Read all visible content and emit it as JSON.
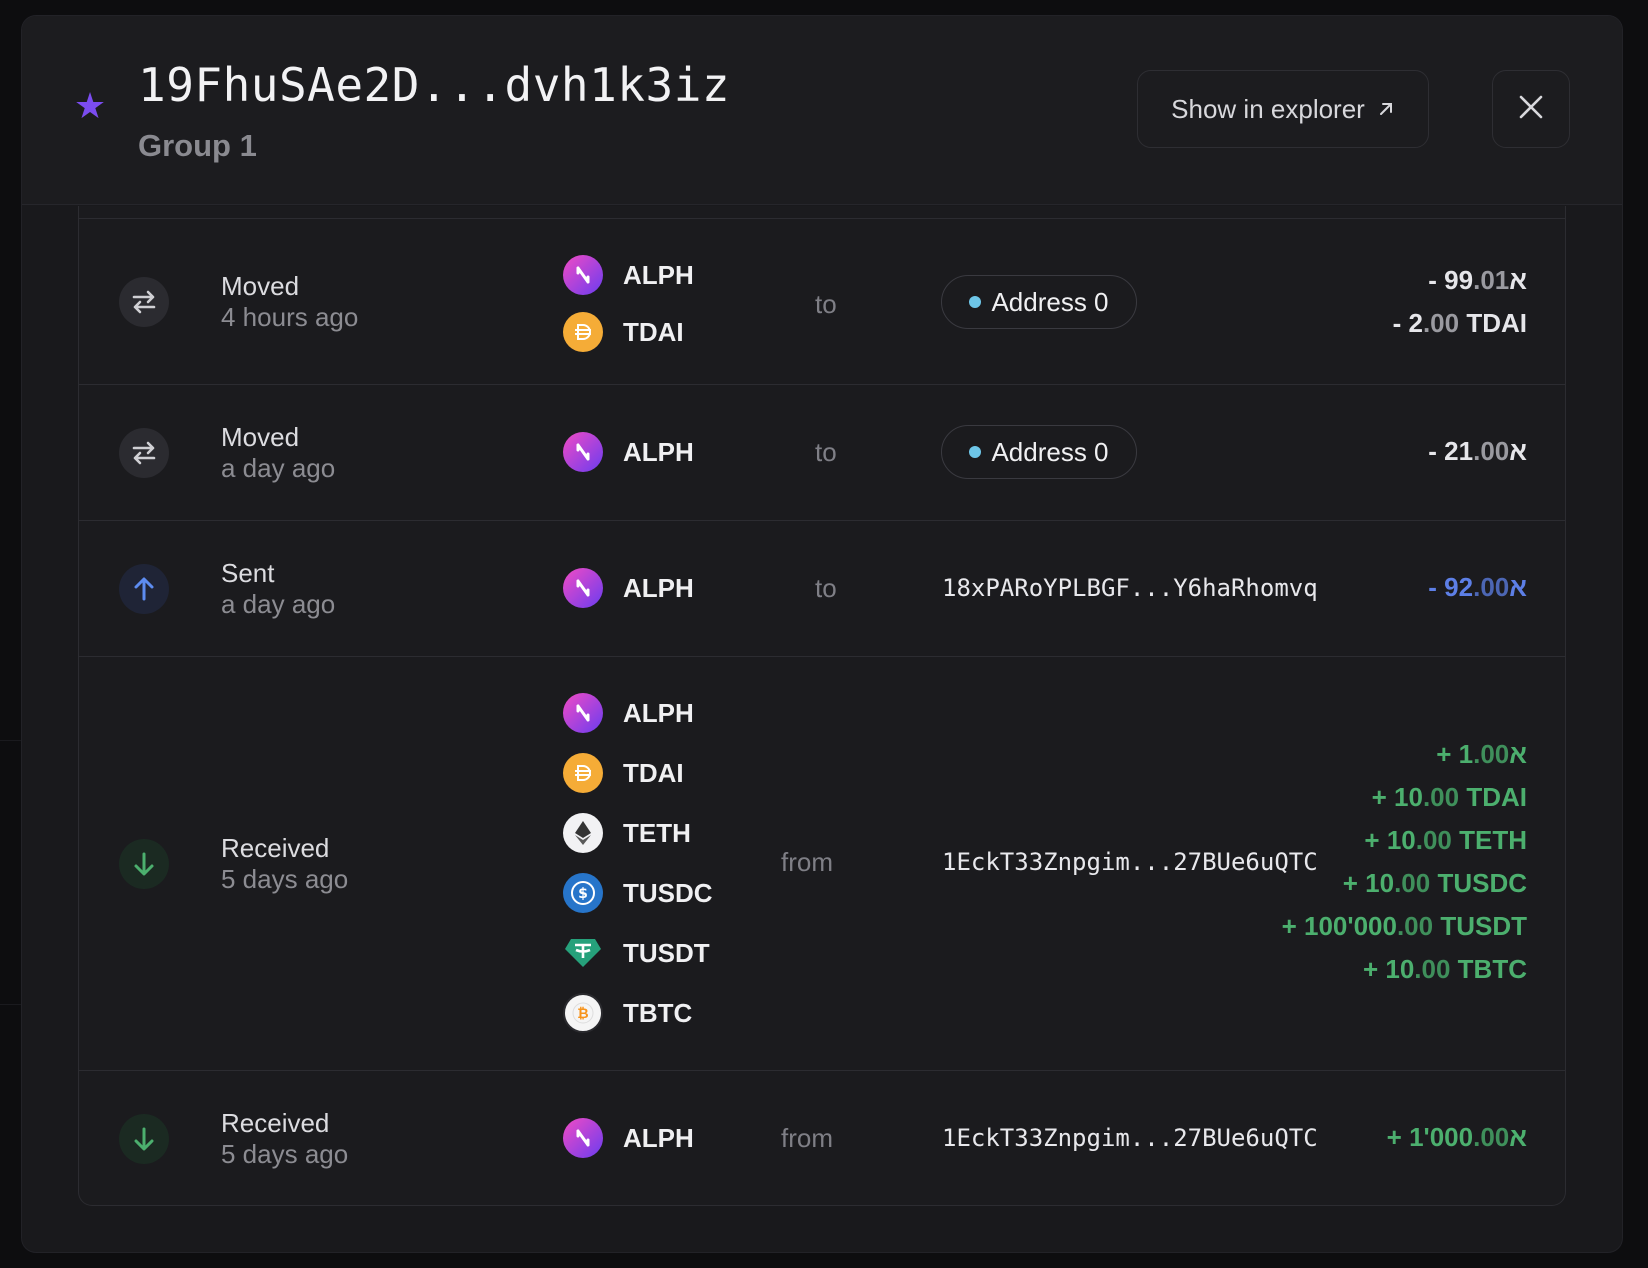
{
  "header": {
    "title": "19FhuSAe2D...dvh1k3iz",
    "subtitle": "Group 1",
    "explorer_label": "Show in explorer",
    "explorer_icon": "external-arrow-icon",
    "close_icon": "close-icon",
    "star_color": "#7b4cf0"
  },
  "transactions": [
    {
      "type": "Moved",
      "time": "4 hours ago",
      "icon": "swap-arrows-icon",
      "assets": [
        "ALPH",
        "TDAI"
      ],
      "direction": "to",
      "counterparty": "Address 0",
      "amounts": [
        {
          "sign": "- ",
          "int": "99",
          "dec": ".01",
          "unit": "א"
        },
        {
          "sign": "- ",
          "int": "2",
          "dec": ".00",
          "unit": " TDAI"
        }
      ]
    },
    {
      "type": "Moved",
      "time": "a day ago",
      "icon": "swap-arrows-icon",
      "assets": [
        "ALPH"
      ],
      "direction": "to",
      "counterparty": "Address 0",
      "amounts": [
        {
          "sign": "- ",
          "int": "21",
          "dec": ".00",
          "unit": "א"
        }
      ]
    },
    {
      "type": "Sent",
      "time": "a day ago",
      "icon": "arrow-up-icon",
      "assets": [
        "ALPH"
      ],
      "direction": "to",
      "counterparty": "18xPARoYPLBGF...Y6haRhomvq",
      "amounts": [
        {
          "sign": "- ",
          "int": "92",
          "dec": ".00",
          "unit": "א"
        }
      ]
    },
    {
      "type": "Received",
      "time": "5 days ago",
      "icon": "arrow-down-icon",
      "assets": [
        "ALPH",
        "TDAI",
        "TETH",
        "TUSDC",
        "TUSDT",
        "TBTC"
      ],
      "direction": "from",
      "counterparty": "1EckT33Znpgim...27BUe6uQTC",
      "amounts": [
        {
          "sign": "+ ",
          "int": "1",
          "dec": ".00",
          "unit": "א"
        },
        {
          "sign": "+ ",
          "int": "10",
          "dec": ".00",
          "unit": " TDAI"
        },
        {
          "sign": "+ ",
          "int": "10",
          "dec": ".00",
          "unit": " TETH"
        },
        {
          "sign": "+ ",
          "int": "10",
          "dec": ".00",
          "unit": " TUSDC"
        },
        {
          "sign": "+ ",
          "int": "100'000",
          "dec": ".00",
          "unit": " TUSDT"
        },
        {
          "sign": "+ ",
          "int": "10",
          "dec": ".00",
          "unit": " TBTC"
        }
      ]
    },
    {
      "type": "Received",
      "time": "5 days ago",
      "icon": "arrow-down-icon",
      "assets": [
        "ALPH"
      ],
      "direction": "from",
      "counterparty": "1EckT33Znpgim...27BUe6uQTC",
      "amounts": [
        {
          "sign": "+ ",
          "int": "1'000",
          "dec": ".00",
          "unit": "א"
        }
      ]
    }
  ],
  "colors": {
    "moved_amount": "#e6e6ea",
    "sent_amount": "#5d7fe6",
    "received_amount": "#4caf6e",
    "address_dot": "#6ec6e8"
  }
}
